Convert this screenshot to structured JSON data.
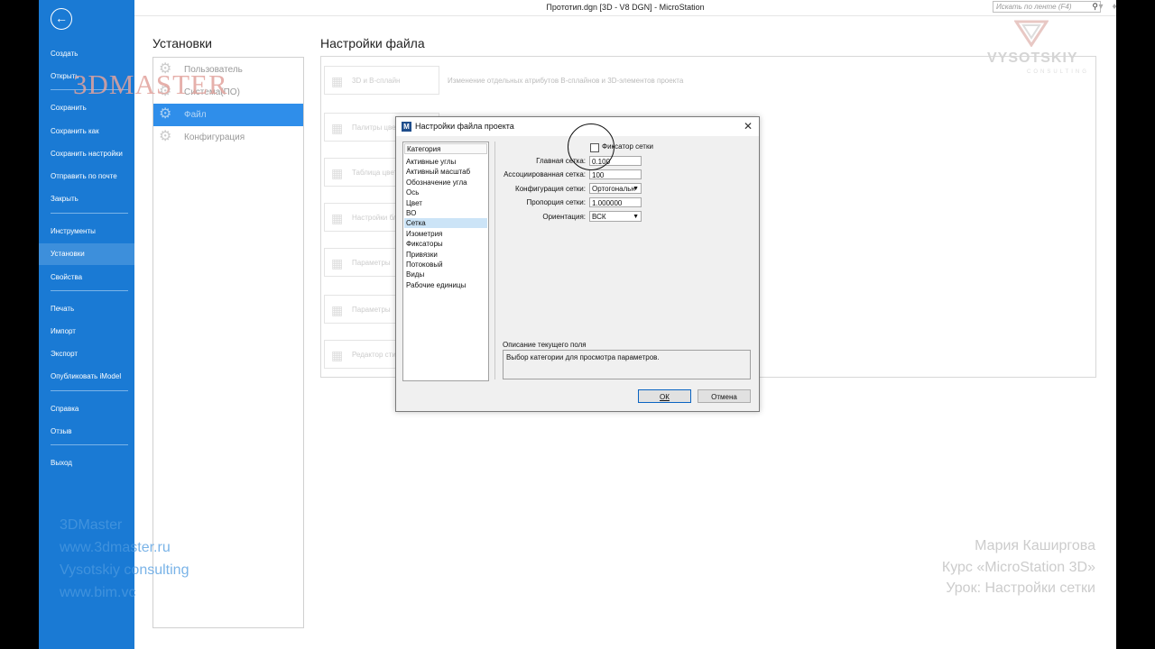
{
  "window": {
    "title": "Прототип.dgn [3D - V8 DGN] - MicroStation",
    "search_placeholder": "Искать по ленте (F4)"
  },
  "backstage": {
    "group1": [
      "Создать",
      "Открыть"
    ],
    "group2": [
      "Сохранить",
      "Сохранить как",
      "Сохранить настройки",
      "Отправить по почте",
      "Закрыть"
    ],
    "group3": [
      "Инструменты",
      "Установки",
      "Свойства"
    ],
    "group4": [
      "Печать",
      "Импорт",
      "Экспорт",
      "Опубликовать iModel"
    ],
    "group5": [
      "Справка",
      "Отзыв"
    ],
    "group6": [
      "Выход"
    ],
    "selected": "Установки"
  },
  "settings": {
    "left_heading": "Установки",
    "right_heading": "Настройки файла",
    "left_items": [
      "Пользователь",
      "Система(ПО)",
      "Файл",
      "Конфигурация"
    ],
    "selected": "Файл",
    "tiles": [
      "3D и В-сплайн",
      "Палитры цветов",
      "Таблица цветов",
      "Настройки блоков",
      "Параметры",
      "Параметры",
      "Редактор стилей"
    ],
    "first_tile_desc": "Изменение отдельных атрибутов B-сплайнов и 3D-элементов проекта"
  },
  "dialog": {
    "title": "Настройки файла проекта",
    "category_header": "Категория",
    "categories": [
      "Активные углы",
      "Активный масштаб",
      "Обозначение угла",
      "Ось",
      "Цвет",
      "ВО",
      "Сетка",
      "Изометрия",
      "Фиксаторы",
      "Привязки",
      "Потоковый",
      "Виды",
      "Рабочие единицы"
    ],
    "selected_category": "Сетка",
    "grid_lock_label": "Фиксатор сетки",
    "grid_lock_checked": false,
    "fields": {
      "master_label": "Главная сетка:",
      "master_value": "0.100",
      "assoc_label": "Ассоциированная сетка:",
      "assoc_value": "100",
      "config_label": "Конфигурация сетки:",
      "config_value": "Ортогональн",
      "ratio_label": "Пропорция сетки:",
      "ratio_value": "1.000000",
      "orient_label": "Ориентация:",
      "orient_value": "ВСК"
    },
    "description_label": "Описание текущего поля",
    "description_text": "Выбор категории для просмотра параметров.",
    "ok_label": "ОК",
    "cancel_label": "Отмена"
  },
  "watermarks": {
    "logo": "3DMASTER",
    "vysotskiy": "VYSOTSKIY",
    "consulting": "CONSULTING",
    "left_lines": [
      "3DMaster",
      "www.3dmaster.ru",
      "Vysotskiy consulting",
      "www.bim.vc"
    ],
    "right_lines": [
      "Мария Каширгова",
      "Курс «MicroStation 3D»",
      "Урок: Настройки сетки"
    ]
  },
  "colors": {
    "backstage_blue": "#1a7ad4",
    "selection_blue": "#2f8eea",
    "logo_red": "#e2a39d"
  }
}
